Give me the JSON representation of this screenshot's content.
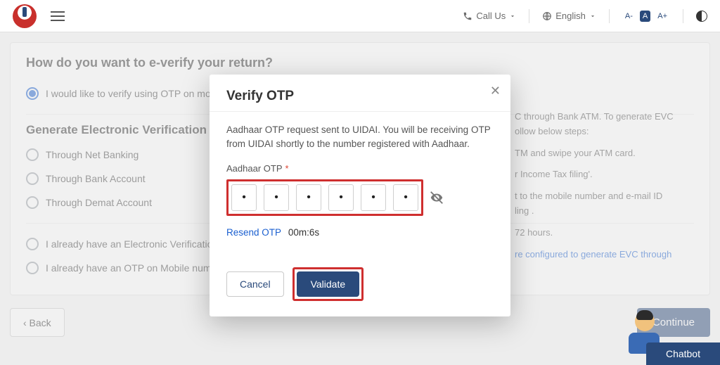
{
  "header": {
    "call_label": "Call Us",
    "language_label": "English",
    "font_minus": "A-",
    "font_normal": "A",
    "font_plus": "A+"
  },
  "page": {
    "question": "How do you want to e-verify your return?",
    "radio_selected": "I would like to verify using OTP on mobile",
    "evc_heading": "Generate Electronic Verification",
    "evc_options": {
      "net_banking": "Through Net Banking",
      "bank_account": "Through Bank Account",
      "demat_account": "Through Demat Account"
    },
    "already_evc": "I already have an Electronic Verification C",
    "already_otp": "I already have an OTP on Mobile number",
    "back_label": "‹  Back",
    "continue_label": "Continue",
    "chatbot_label": "Chatbot"
  },
  "side_info": {
    "line1": "C through Bank ATM. To generate EVC",
    "line2": "ollow below steps:",
    "line3": "TM and swipe your ATM card.",
    "line4": "r Income Tax filing'.",
    "line5": "t to the mobile number and e-mail ID",
    "line6": "ling .",
    "line7": "72 hours.",
    "link": "re configured to generate EVC through"
  },
  "modal": {
    "title": "Verify OTP",
    "description": "Aadhaar OTP request sent to UIDAI. You will be receiving OTP from UIDAI shortly to the number registered with Aadhaar.",
    "otp_label": "Aadhaar OTP",
    "otp_values": [
      "•",
      "•",
      "•",
      "•",
      "•",
      "•"
    ],
    "resend_label": "Resend OTP",
    "timer": "00m:6s",
    "cancel_label": "Cancel",
    "validate_label": "Validate"
  }
}
